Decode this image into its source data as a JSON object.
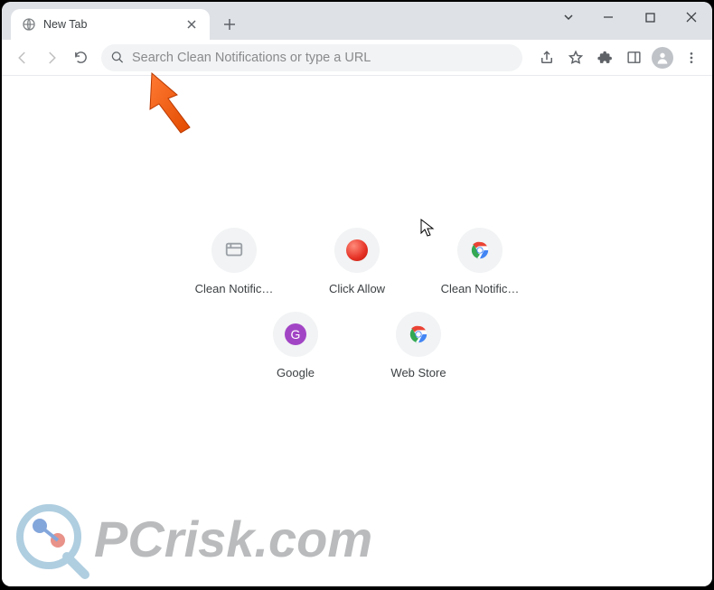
{
  "tab": {
    "title": "New Tab"
  },
  "omnibox": {
    "placeholder": "Search Clean Notifications or type a URL"
  },
  "shortcuts": [
    {
      "label": "Clean Notific…",
      "icon": "tool"
    },
    {
      "label": "Click Allow",
      "icon": "red"
    },
    {
      "label": "Clean Notific…",
      "icon": "chrome"
    },
    {
      "label": "Google",
      "icon": "google-g",
      "letter": "G"
    },
    {
      "label": "Web Store",
      "icon": "chrome"
    }
  ],
  "watermark": "PCrisk.com"
}
